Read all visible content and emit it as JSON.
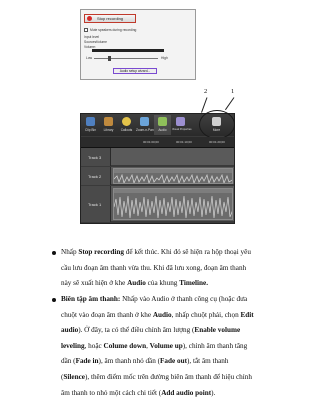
{
  "recording_dialog": {
    "stop_button": "Stop recording",
    "options": {
      "show_speakers": "Mute speakers during recording",
      "input_level": "Input level",
      "sources": "Sources:",
      "source_value": "Volume",
      "volume": "Volume:",
      "low": "Low",
      "high": "High"
    },
    "setup_button": "Audio setup wizard..."
  },
  "editor": {
    "toolbar": [
      {
        "label": "Clip Bin",
        "color": "#4f7fbf"
      },
      {
        "label": "Library",
        "color": "#c08a3e"
      },
      {
        "label": "Callouts",
        "color": "#e3c34a"
      },
      {
        "label": "Zoom-n-Pan",
        "color": "#6aa3d8"
      },
      {
        "label": "Audio",
        "color": "#8fbf5a"
      },
      {
        "label": "Visual Properties",
        "color": "#9c8fd0"
      },
      {
        "label": "More",
        "color": "#d0d0d0"
      }
    ],
    "markers": [
      "2",
      "1"
    ],
    "time_ticks": [
      "00:01:00;00",
      "00:01:10;00",
      "00:01:20;00"
    ],
    "tracks": [
      "Track 3",
      "Track 2",
      "Track 1"
    ]
  },
  "content": {
    "item1": {
      "lines": [
        [
          "Nhấp ",
          {
            "b": "Stop recording"
          },
          " để kết thúc. Khi đó sẽ hiện ra hộp thoại yêu"
        ],
        [
          "cầu lưu đoạn âm thanh vừa thu. Khi đã lưu xong, đoạn âm thanh"
        ],
        [
          "này sẽ xuất hiện ở khe ",
          {
            "b": "Audio"
          },
          " của khung ",
          {
            "b": "Timeline."
          }
        ]
      ]
    },
    "item2": {
      "lines": [
        [
          {
            "b": "Biên tập âm thanh:"
          },
          " Nhấp vào Audio ở thanh công cụ (hoặc đưa"
        ],
        [
          "chuột vào đoạn âm thanh ở khe ",
          {
            "b": "Audio"
          },
          ", nhấp chuột phải, chọn ",
          {
            "b": "Edit"
          }
        ],
        [
          {
            "b": "audio"
          },
          "). Ở đây, ta có thể điều chỉnh âm lượng (",
          {
            "b": "Enable volume"
          }
        ],
        [
          {
            "b": "leveling"
          },
          ", hoặc ",
          {
            "b": "Colume down"
          },
          ", ",
          {
            "b": "Volume up"
          },
          "), chỉnh âm thanh tăng"
        ],
        [
          "dần (",
          {
            "b": "Fade in"
          },
          "), âm thanh nhỏ dần (",
          {
            "b": "Fade out"
          },
          "), tắt âm thanh"
        ],
        [
          "(",
          {
            "b": "Silence"
          },
          "), thêm điểm mốc trên đường biên âm thanh để hiệu chỉnh"
        ],
        [
          "âm thanh to nhỏ một cách chi tiết (",
          {
            "b": "Add audio point"
          },
          ")."
        ]
      ]
    }
  }
}
